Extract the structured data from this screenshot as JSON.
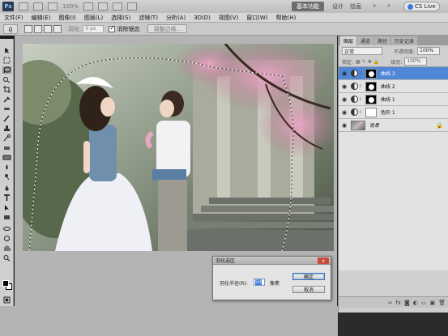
{
  "app": {
    "logo": "Ps",
    "zoom": "100%",
    "workspace_button": "基本功能",
    "workspace_links": [
      "设计",
      "绘画"
    ],
    "cs_live": "CS Live"
  },
  "menu": [
    "文件(F)",
    "编辑(E)",
    "图像(I)",
    "图层(L)",
    "选择(S)",
    "滤镜(T)",
    "分析(A)",
    "3D(D)",
    "视图(V)",
    "窗口(W)",
    "帮助(H)"
  ],
  "options": {
    "feather_label": "羽化:",
    "feather_value": "0 px",
    "antialias_label": "消除锯齿",
    "refine_edge": "调整边缘..."
  },
  "layers_panel": {
    "tabs": [
      "图层",
      "通道",
      "路径",
      "历史记录"
    ],
    "blend_mode": "正常",
    "opacity_label": "不透明度:",
    "opacity_value": "100%",
    "lock_label": "锁定:",
    "fill_label": "填充:",
    "fill_value": "100%",
    "layers": [
      {
        "name": "曲线 3",
        "selected": true
      },
      {
        "name": "曲线 2",
        "selected": false
      },
      {
        "name": "曲线 1",
        "selected": false
      },
      {
        "name": "色阶 1",
        "selected": false
      },
      {
        "name": "背景",
        "selected": false
      }
    ]
  },
  "dialog": {
    "title": "羽化选区",
    "close": "x",
    "radius_label": "羽化半径(R):",
    "radius_value": "50",
    "unit": "像素",
    "ok": "确定",
    "cancel": "取消"
  },
  "colors": {
    "selected_layer": "#4f86d6",
    "close_button": "#c84a3c"
  }
}
